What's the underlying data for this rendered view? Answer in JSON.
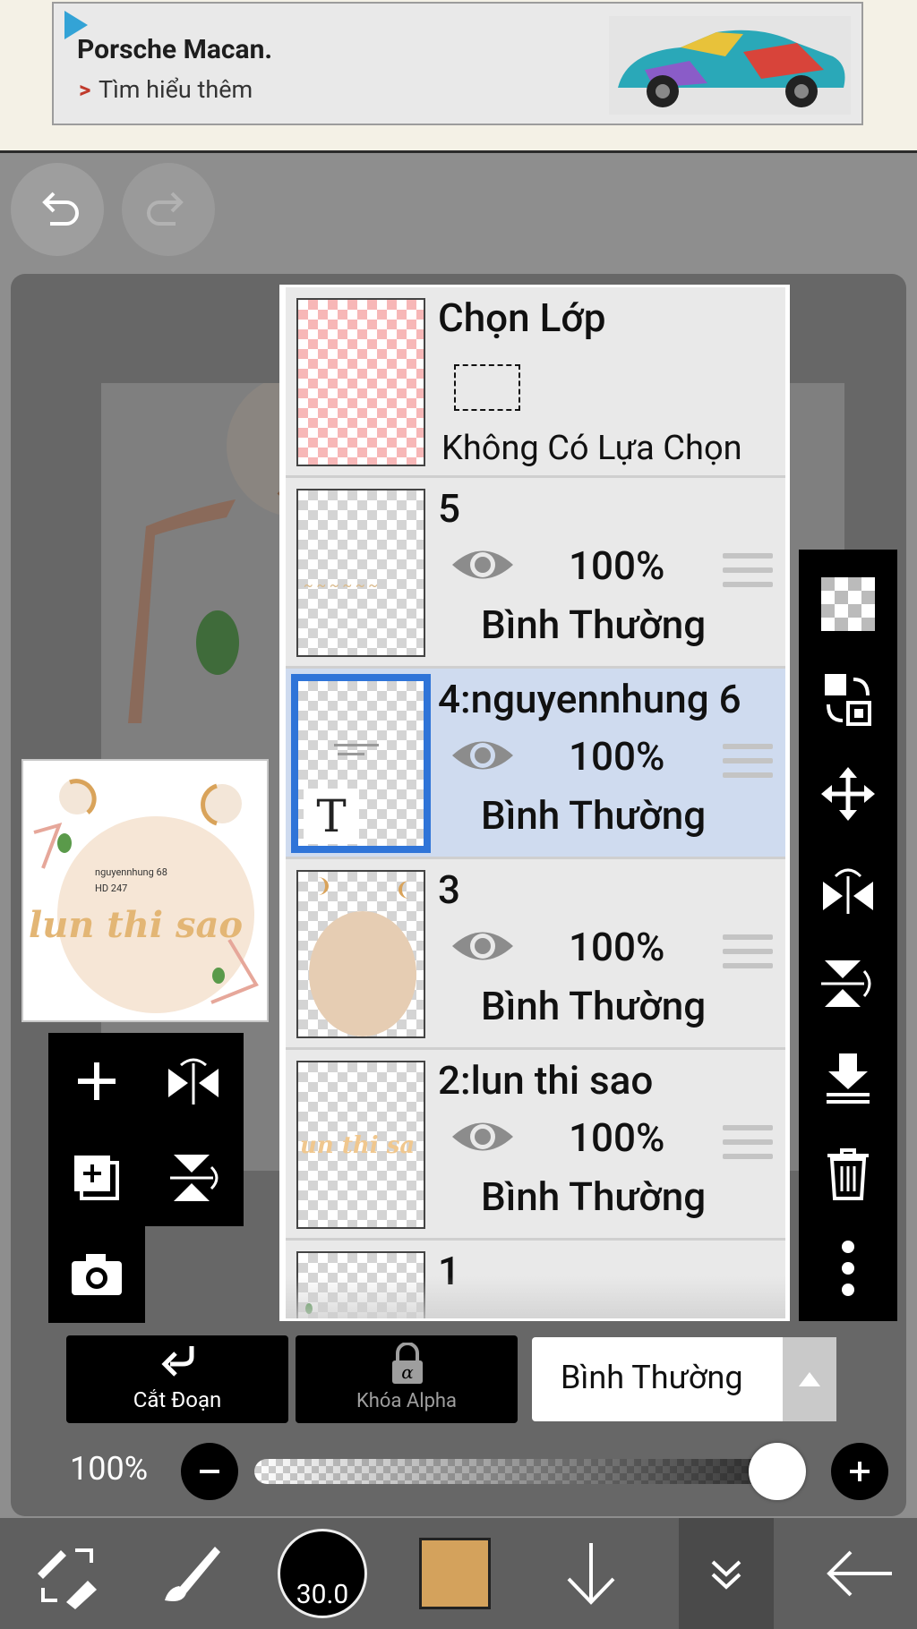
{
  "ad": {
    "title": "Porsche Macan.",
    "link": "Tìm hiểu thêm",
    "chevron": ">"
  },
  "preview": {
    "line1": "nguyennhung 68",
    "line2": "HD 247",
    "script_text": "lun thi sao"
  },
  "layers": [
    {
      "name": "Chọn Lớp",
      "sublabel": "Không Có Lựa Chọn",
      "type": "selection"
    },
    {
      "name": "5",
      "opacity": "100%",
      "blend": "Bình Thường"
    },
    {
      "name": "4:nguyennhung 6",
      "opacity": "100%",
      "blend": "Bình Thường",
      "selected": true,
      "text_layer_icon": "T"
    },
    {
      "name": "3",
      "opacity": "100%",
      "blend": "Bình Thường"
    },
    {
      "name": "2:lun thi sao",
      "opacity": "100%",
      "blend": "Bình Thường"
    },
    {
      "name": "1"
    }
  ],
  "actions": {
    "cut_label": "Cắt Đoạn",
    "alpha_label": "Khóa Alpha",
    "blend_mode": "Bình Thường"
  },
  "opacity_row": {
    "value": "100%",
    "level": 1.0
  },
  "bottom_bar": {
    "brush_size": "30.0",
    "color": "#d4a25c"
  },
  "colors": {
    "selected_border": "#2f74d8",
    "selected_row": "#cfdbef"
  }
}
